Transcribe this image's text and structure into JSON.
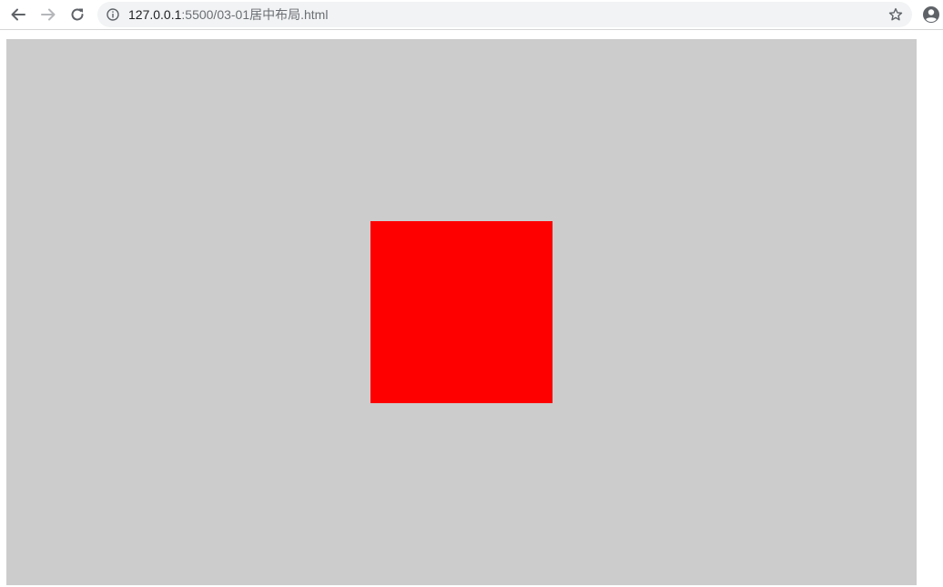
{
  "browser": {
    "url_host": "127.0.0.1",
    "url_path": ":5500/03-01居中布局.html",
    "icons": {
      "back": "arrow-left-icon",
      "forward": "arrow-right-icon",
      "reload": "reload-icon",
      "info": "info-icon",
      "bookmark": "star-icon",
      "profile": "account-circle-icon"
    }
  },
  "page": {
    "colors": {
      "outer_box": "#cccccc",
      "inner_box": "#ff0000",
      "background": "#ffffff"
    }
  }
}
